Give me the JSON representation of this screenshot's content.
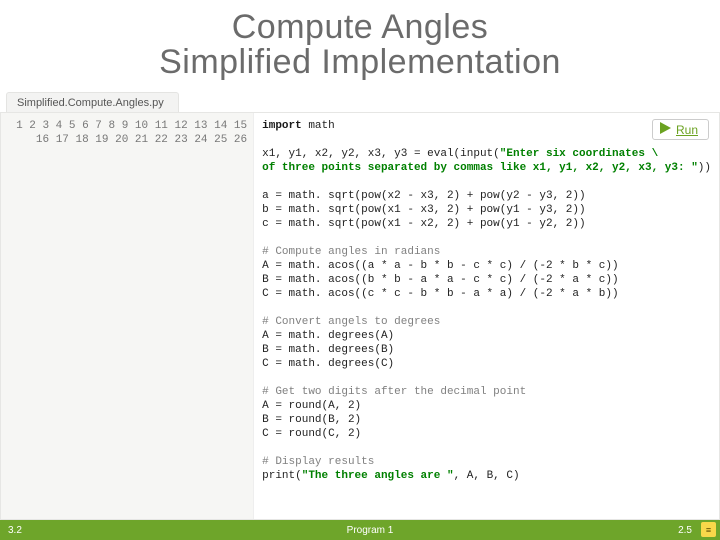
{
  "title": {
    "line1": "Compute Angles",
    "line2": "Simplified Implementation"
  },
  "fileTab": "Simplified.Compute.Angles.py",
  "runLabel": "Run",
  "gutterLines": [
    "1",
    "2",
    "3",
    "4",
    "5",
    "6",
    "7",
    "8",
    "9",
    "10",
    "11",
    "12",
    "13",
    "14",
    "15",
    "16",
    "17",
    "18",
    "19",
    "20",
    "21",
    "22",
    "23",
    "24",
    "25",
    "26"
  ],
  "code": {
    "l1_kw": "import",
    "l1_rest": " math",
    "l3a": "x1, y1, x2, y2, x3, y3 = eval(input(",
    "l3s": "\"Enter six coordinates \\",
    "l4a": "of three points separated by commas like x1, y1, x2, y2, x3, y3: \"",
    "l4b": "))",
    "l6": "a = math. sqrt(pow(x2 - x3, 2) + pow(y2 - y3, 2))",
    "l7": "b = math. sqrt(pow(x1 - x3, 2) + pow(y1 - y3, 2))",
    "l8": "c = math. sqrt(pow(x1 - x2, 2) + pow(y1 - y2, 2))",
    "c10": "# Compute angles in radians",
    "l11": "A = math. acos((a * a - b * b - c * c) / (-2 * b * c))",
    "l12": "B = math. acos((b * b - a * a - c * c) / (-2 * a * c))",
    "l13": "C = math. acos((c * c - b * b - a * a) / (-2 * a * b))",
    "c15": "# Convert angels to degrees",
    "l16": "A = math. degrees(A)",
    "l17": "B = math. degrees(B)",
    "l18": "C = math. degrees(C)",
    "c20": "# Get two digits after the decimal point",
    "l21": "A = round(A, 2)",
    "l22": "B = round(B, 2)",
    "l23": "C = round(C, 2)",
    "c25": "# Display results",
    "l26a": "print(",
    "l26s": "\"The three angles are \"",
    "l26b": ", A, B, C)"
  },
  "footer": {
    "left": "3.2",
    "mid": "Program 1",
    "right": "2.5",
    "logo": "≡"
  }
}
